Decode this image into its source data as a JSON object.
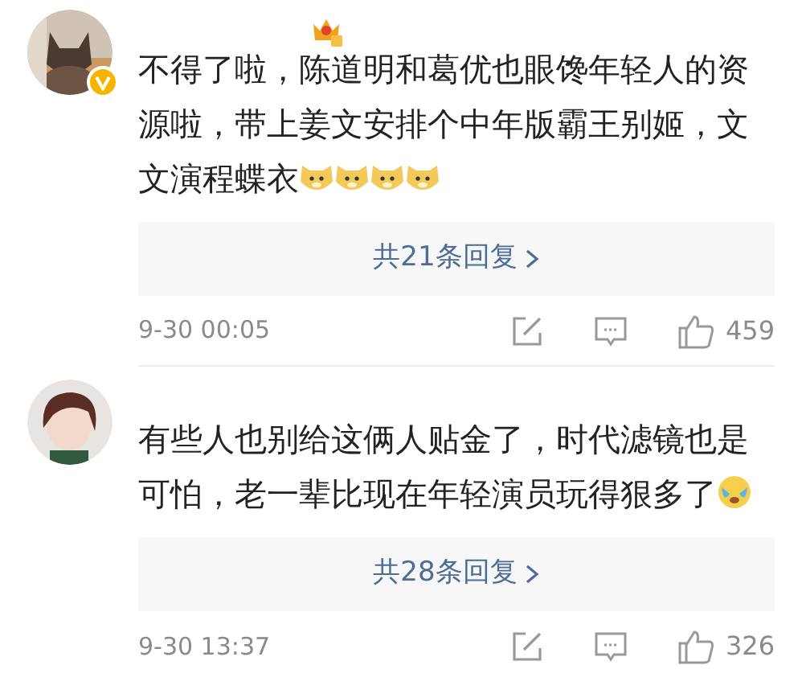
{
  "comments": [
    {
      "avatar": {
        "kind": "picture",
        "verified": true
      },
      "member_badge": true,
      "text": "不得了啦，陈道明和葛优也眼馋年轻人的资源啦，带上姜文安排个中年版霸王别姬，文文演程蝶衣",
      "emojis": [
        {
          "kind": "doge"
        },
        {
          "kind": "doge"
        },
        {
          "kind": "doge"
        },
        {
          "kind": "doge"
        }
      ],
      "replies": "共21条回复",
      "time": "9-30 00:05",
      "likes": "459"
    },
    {
      "avatar": {
        "kind": "picture",
        "verified": false
      },
      "member_badge": false,
      "text": "有些人也别给这俩人贴金了，时代滤镜也是可怕，老一辈比现在年轻演员玩得狠多了",
      "emojis": [
        {
          "kind": "cry"
        }
      ],
      "replies": "共28条回复",
      "time": "9-30 13:37",
      "likes": "326"
    }
  ]
}
